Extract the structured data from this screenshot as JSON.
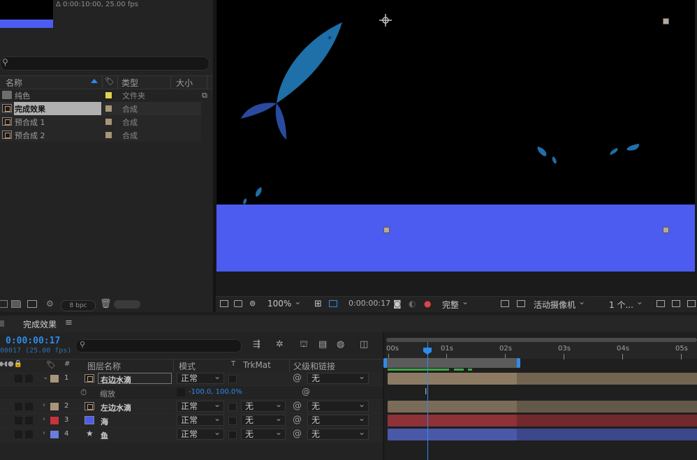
{
  "project": {
    "info": "Δ 0:00:10:00, 25.00 fps",
    "columns": {
      "name": "名称",
      "type": "类型",
      "size": "大小"
    },
    "items": [
      {
        "name": "纯色",
        "type": "文件夹",
        "swatch": "#e0d24f",
        "icon": "folder-icon",
        "selected": false
      },
      {
        "name": "完成效果",
        "type": "合成",
        "swatch": "#a8967a",
        "icon": "composition-icon",
        "selected": true
      },
      {
        "name": "预合成 1",
        "type": "合成",
        "swatch": "#a8967a",
        "icon": "composition-icon",
        "selected": false
      },
      {
        "name": "预合成 2",
        "type": "合成",
        "swatch": "#a8967a",
        "icon": "composition-icon",
        "selected": false
      }
    ],
    "bpc": "8 bpc"
  },
  "viewer": {
    "colors": {
      "background": "#000000",
      "sea": "#4c5cf0",
      "fish": "#1f6fa8"
    },
    "toolbar": {
      "zoom": "100%",
      "timecode": "0:00:00:17",
      "resolution": "完整",
      "camera": "活动摄像机",
      "views": "1 个..."
    }
  },
  "timeline": {
    "comp_name": "完成效果",
    "timecode": "0:00:00:17",
    "frames": "00017 (25.00 fps)",
    "columns": {
      "num": "#",
      "layer_name": "图层名称",
      "mode": "模式",
      "t": "T",
      "trkmat": "TrkMat",
      "parent": "父级和链接"
    },
    "ruler": [
      "00s",
      "01s",
      "02s",
      "03s",
      "04s",
      "05s"
    ],
    "layers": [
      {
        "num": "1",
        "name": "右边水滴",
        "label": "#a8967a",
        "src": "composition-icon",
        "mode": "正常",
        "trkmat": "",
        "parent": "无",
        "bar": "#8c7b62",
        "expanded": true
      },
      {
        "num": "2",
        "name": "左边水滴",
        "label": "#a8967a",
        "src": "composition-icon",
        "mode": "正常",
        "trkmat": "无",
        "parent": "无",
        "bar": "#7a6c58"
      },
      {
        "num": "3",
        "name": "海",
        "label": "#c8323a",
        "src": "solid-icon",
        "mode": "正常",
        "trkmat": "无",
        "parent": "无",
        "bar": "#8c3238"
      },
      {
        "num": "4",
        "name": "鱼",
        "label": "#6a7ee0",
        "src": "star-icon",
        "mode": "正常",
        "trkmat": "无",
        "parent": "无",
        "bar": "#4a58a8"
      }
    ],
    "property": {
      "name": "缩放",
      "value": "-100.0, 100.0%"
    }
  }
}
